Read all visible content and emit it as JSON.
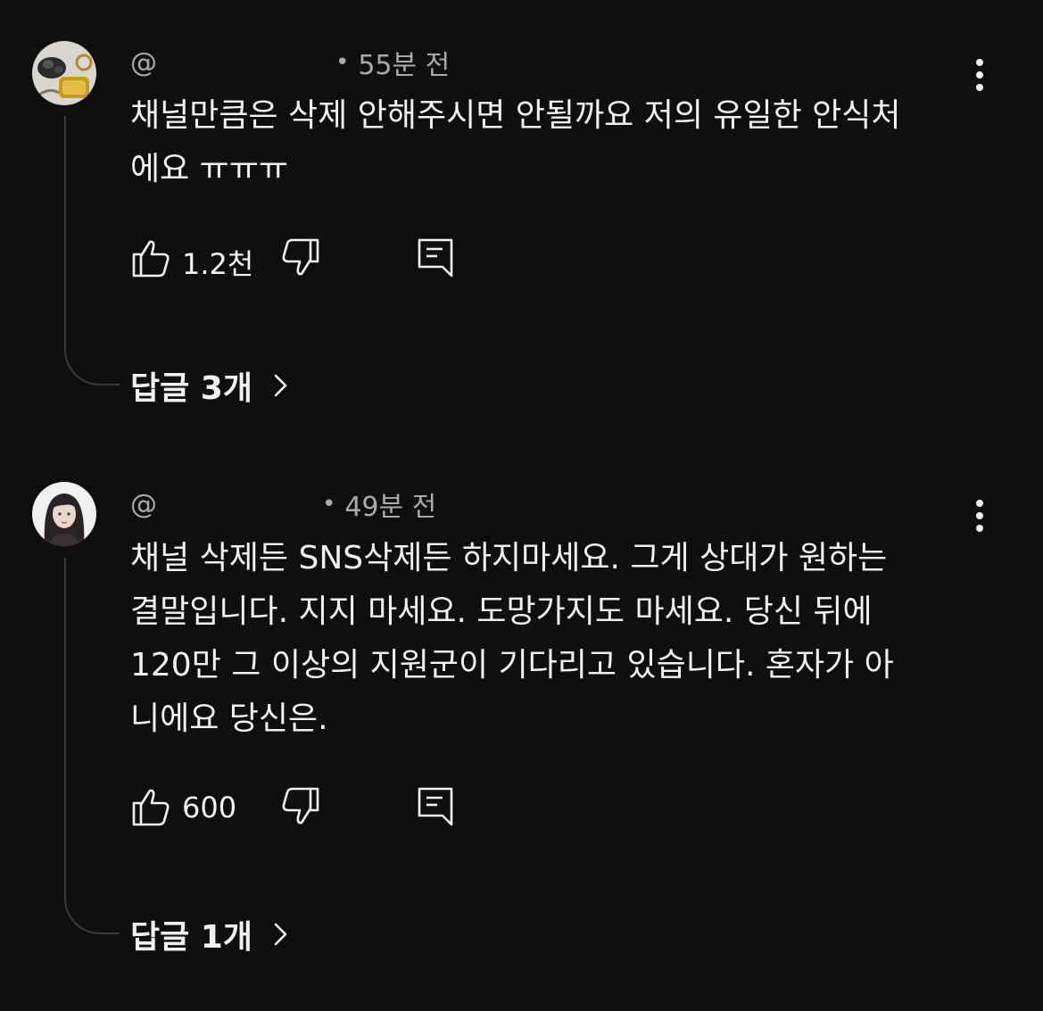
{
  "comments": [
    {
      "handle_prefix": "@",
      "time": "55분 전",
      "text": "채널만큼은 삭제 안해주시면 안될까요 저의 유일한 안식처\n에요 ㅠㅠㅠ",
      "likes": "1.2천",
      "replies_label": "답글 3개",
      "avatar": "keychain-avatar"
    },
    {
      "handle_prefix": "@",
      "time": "49분 전",
      "text": "채널 삭제든 SNS삭제든 하지마세요. 그게 상대가 원하는\n결말입니다. 지지 마세요. 도망가지도 마세요. 당신 뒤에\n120만 그 이상의 지원군이 기다리고 있습니다. 혼자가 아\n니에요 당신은.",
      "likes": "600",
      "replies_label": "답글 1개",
      "avatar": "woman-portrait-avatar"
    }
  ],
  "icons": {
    "like": "thumbs-up-icon",
    "dislike": "thumbs-down-icon",
    "reply": "reply-comment-icon",
    "more": "more-vertical-icon",
    "chevron": "chevron-right-icon"
  },
  "colors": {
    "background": "#0f0f0f",
    "text": "#f1f1f1",
    "secondary_text": "#aaaaaa",
    "thread_line": "#3a3a3a"
  }
}
